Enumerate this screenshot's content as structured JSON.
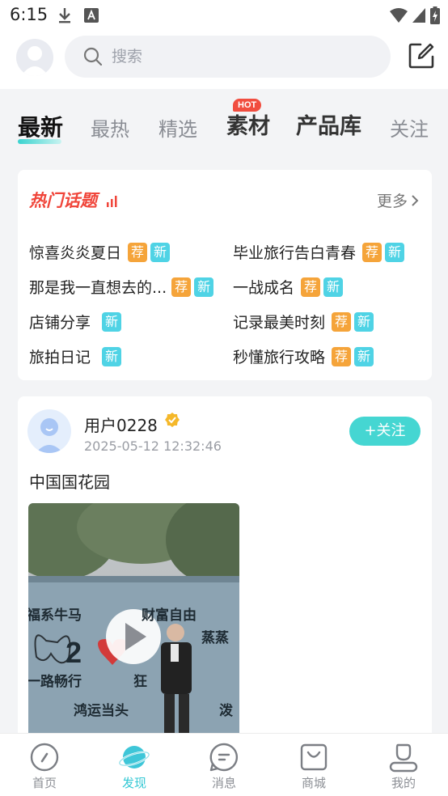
{
  "status_bar": {
    "time": "6:15"
  },
  "header": {
    "search_placeholder": "搜索"
  },
  "tabs": [
    {
      "label": "最新",
      "active": true
    },
    {
      "label": "最热"
    },
    {
      "label": "精选"
    },
    {
      "label": "素材",
      "badge": "HOT"
    },
    {
      "label": "产品库"
    },
    {
      "label": "关注"
    }
  ],
  "hot_topics": {
    "title": "热门话题",
    "more_label": "更多",
    "tag_recommend": "荐",
    "tag_new": "新",
    "items": [
      {
        "label": "惊喜炎炎夏日",
        "recommend": true,
        "new": true
      },
      {
        "label": "毕业旅行告白青春",
        "recommend": true,
        "new": true
      },
      {
        "label": "那是我一直想去的...",
        "recommend": true,
        "new": true
      },
      {
        "label": "一战成名",
        "recommend": true,
        "new": true
      },
      {
        "label": "店铺分享",
        "recommend": false,
        "new": true
      },
      {
        "label": "记录最美时刻",
        "recommend": true,
        "new": true
      },
      {
        "label": "旅拍日记",
        "recommend": false,
        "new": true
      },
      {
        "label": "秒懂旅行攻略",
        "recommend": true,
        "new": true
      }
    ]
  },
  "post": {
    "user": "用户0228",
    "time": "2025-05-12 12:32:46",
    "follow_label": "+关注",
    "text": "中国国花园",
    "media_texts": {
      "line1a": "福系牛马",
      "line1b": "财富自由",
      "line2": "蒸蒸",
      "line3a": "一路畅行",
      "line3b": "狂",
      "line4": "鸿运当头",
      "line4b": "泼",
      "year": "2"
    }
  },
  "bottom_nav": [
    {
      "label": "首页"
    },
    {
      "label": "发现",
      "active": true
    },
    {
      "label": "消息"
    },
    {
      "label": "商城"
    },
    {
      "label": "我的"
    }
  ],
  "colors": {
    "accent": "#34c8d4",
    "hot_red": "#f0453a",
    "tag_recommend": "#f5a43a",
    "tag_new": "#4fd3e5",
    "follow": "#45d6d2"
  }
}
